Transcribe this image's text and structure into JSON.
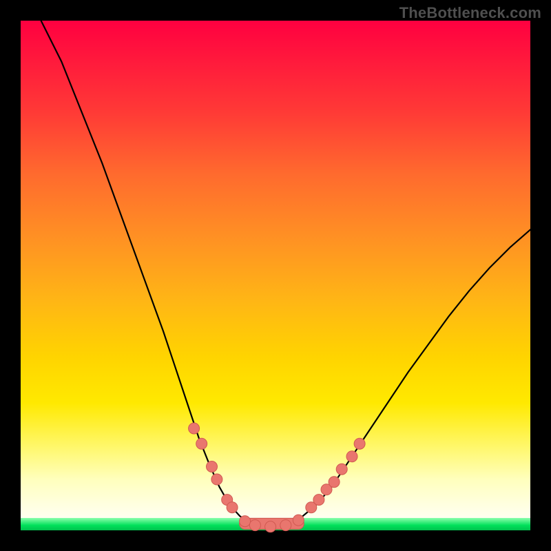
{
  "watermark": "TheBottleneck.com",
  "colors": {
    "curve_stroke": "#000000",
    "marker_fill": "#e9766e",
    "marker_stroke": "#d05951"
  },
  "chart_data": {
    "type": "line",
    "title": "",
    "xlabel": "",
    "ylabel": "",
    "xlim": [
      0,
      100
    ],
    "ylim": [
      0,
      100
    ],
    "curve": [
      {
        "x": 4.0,
        "y": 100.0
      },
      {
        "x": 8.0,
        "y": 92.0
      },
      {
        "x": 12.0,
        "y": 82.0
      },
      {
        "x": 16.0,
        "y": 72.0
      },
      {
        "x": 20.0,
        "y": 61.0
      },
      {
        "x": 24.0,
        "y": 50.0
      },
      {
        "x": 28.0,
        "y": 39.0
      },
      {
        "x": 31.0,
        "y": 30.0
      },
      {
        "x": 33.0,
        "y": 24.0
      },
      {
        "x": 35.0,
        "y": 18.0
      },
      {
        "x": 37.0,
        "y": 13.0
      },
      {
        "x": 39.0,
        "y": 8.5
      },
      {
        "x": 41.0,
        "y": 5.0
      },
      {
        "x": 43.0,
        "y": 2.8
      },
      {
        "x": 45.0,
        "y": 1.4
      },
      {
        "x": 47.0,
        "y": 0.7
      },
      {
        "x": 49.0,
        "y": 0.5
      },
      {
        "x": 51.0,
        "y": 0.7
      },
      {
        "x": 53.0,
        "y": 1.3
      },
      {
        "x": 55.0,
        "y": 2.5
      },
      {
        "x": 58.0,
        "y": 5.0
      },
      {
        "x": 61.0,
        "y": 8.5
      },
      {
        "x": 64.0,
        "y": 13.0
      },
      {
        "x": 68.0,
        "y": 19.0
      },
      {
        "x": 72.0,
        "y": 25.0
      },
      {
        "x": 76.0,
        "y": 31.0
      },
      {
        "x": 80.0,
        "y": 36.5
      },
      {
        "x": 84.0,
        "y": 42.0
      },
      {
        "x": 88.0,
        "y": 47.0
      },
      {
        "x": 92.0,
        "y": 51.5
      },
      {
        "x": 96.0,
        "y": 55.5
      },
      {
        "x": 100.0,
        "y": 59.0
      }
    ],
    "markers_left": [
      {
        "x": 34.0,
        "y": 20.0
      },
      {
        "x": 35.5,
        "y": 17.0
      },
      {
        "x": 37.5,
        "y": 12.5
      },
      {
        "x": 38.5,
        "y": 10.0
      },
      {
        "x": 40.5,
        "y": 6.0
      },
      {
        "x": 41.5,
        "y": 4.5
      }
    ],
    "markers_bottom": [
      {
        "x": 44.0,
        "y": 1.8
      },
      {
        "x": 46.0,
        "y": 1.0
      },
      {
        "x": 49.0,
        "y": 0.7
      },
      {
        "x": 52.0,
        "y": 1.0
      },
      {
        "x": 54.5,
        "y": 2.0
      }
    ],
    "markers_right": [
      {
        "x": 57.0,
        "y": 4.5
      },
      {
        "x": 58.5,
        "y": 6.0
      },
      {
        "x": 60.0,
        "y": 8.0
      },
      {
        "x": 61.5,
        "y": 9.5
      },
      {
        "x": 63.0,
        "y": 12.0
      },
      {
        "x": 65.0,
        "y": 14.5
      },
      {
        "x": 66.5,
        "y": 17.0
      }
    ]
  }
}
